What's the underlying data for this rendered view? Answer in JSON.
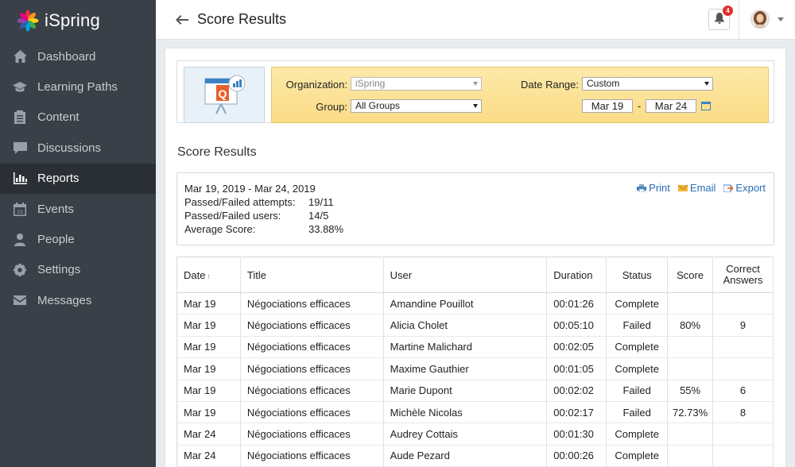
{
  "app": {
    "logo_text": "iSpring"
  },
  "sidebar": {
    "items": [
      {
        "label": "Dashboard",
        "icon": "home-icon",
        "active": false
      },
      {
        "label": "Learning Paths",
        "icon": "graduation-cap-icon",
        "active": false
      },
      {
        "label": "Content",
        "icon": "document-icon",
        "active": false
      },
      {
        "label": "Discussions",
        "icon": "chat-icon",
        "active": false
      },
      {
        "label": "Reports",
        "icon": "bar-chart-icon",
        "active": true
      },
      {
        "label": "Events",
        "icon": "calendar-icon",
        "active": false
      },
      {
        "label": "People",
        "icon": "person-icon",
        "active": false
      },
      {
        "label": "Settings",
        "icon": "gear-icon",
        "active": false
      },
      {
        "label": "Messages",
        "icon": "envelope-icon",
        "active": false
      }
    ]
  },
  "header": {
    "title": "Score Results",
    "notifications_count": "4"
  },
  "filters": {
    "organization_label": "Organization:",
    "organization_value": "iSpring",
    "group_label": "Group:",
    "group_value": "All Groups",
    "date_range_label": "Date Range:",
    "date_range_value": "Custom",
    "date_from": "Mar 19",
    "date_separator": "-",
    "date_to": "Mar 24"
  },
  "section_title": "Score Results",
  "summary": {
    "range": "Mar 19, 2019 - Mar 24, 2019",
    "rows": [
      {
        "label": "Passed/Failed attempts:",
        "value": "19/11"
      },
      {
        "label": "Passed/Failed users:",
        "value": "14/5"
      },
      {
        "label": "Average Score:",
        "value": "33.88%"
      }
    ],
    "actions": {
      "print": "Print",
      "email": "Email",
      "export": "Export"
    }
  },
  "table": {
    "columns": {
      "date": "Date",
      "title": "Title",
      "user": "User",
      "duration": "Duration",
      "status": "Status",
      "score": "Score",
      "correct_line1": "Correct",
      "correct_line2": "Answers"
    },
    "rows": [
      {
        "date": "Mar 19",
        "title": "Négociations efficaces",
        "user": "Amandine Pouillot",
        "duration": "00:01:26",
        "status": "Complete",
        "score": "",
        "correct": ""
      },
      {
        "date": "Mar 19",
        "title": "Négociations efficaces",
        "user": "Alicia Cholet",
        "duration": "00:05:10",
        "status": "Failed",
        "score": "80%",
        "correct": "9"
      },
      {
        "date": "Mar 19",
        "title": "Négociations efficaces",
        "user": "Martine Malichard",
        "duration": "00:02:05",
        "status": "Complete",
        "score": "",
        "correct": ""
      },
      {
        "date": "Mar 19",
        "title": "Négociations efficaces",
        "user": "Maxime Gauthier",
        "duration": "00:01:05",
        "status": "Complete",
        "score": "",
        "correct": ""
      },
      {
        "date": "Mar 19",
        "title": "Négociations efficaces",
        "user": "Marie Dupont",
        "duration": "00:02:02",
        "status": "Failed",
        "score": "55%",
        "correct": "6"
      },
      {
        "date": "Mar 19",
        "title": "Négociations efficaces",
        "user": "Michèle Nicolas",
        "duration": "00:02:17",
        "status": "Failed",
        "score": "72.73%",
        "correct": "8"
      },
      {
        "date": "Mar 24",
        "title": "Négociations efficaces",
        "user": "Audrey Cottais",
        "duration": "00:01:30",
        "status": "Complete",
        "score": "",
        "correct": ""
      },
      {
        "date": "Mar 24",
        "title": "Négociations efficaces",
        "user": "Aude Pezard",
        "duration": "00:00:26",
        "status": "Complete",
        "score": "",
        "correct": ""
      }
    ]
  }
}
